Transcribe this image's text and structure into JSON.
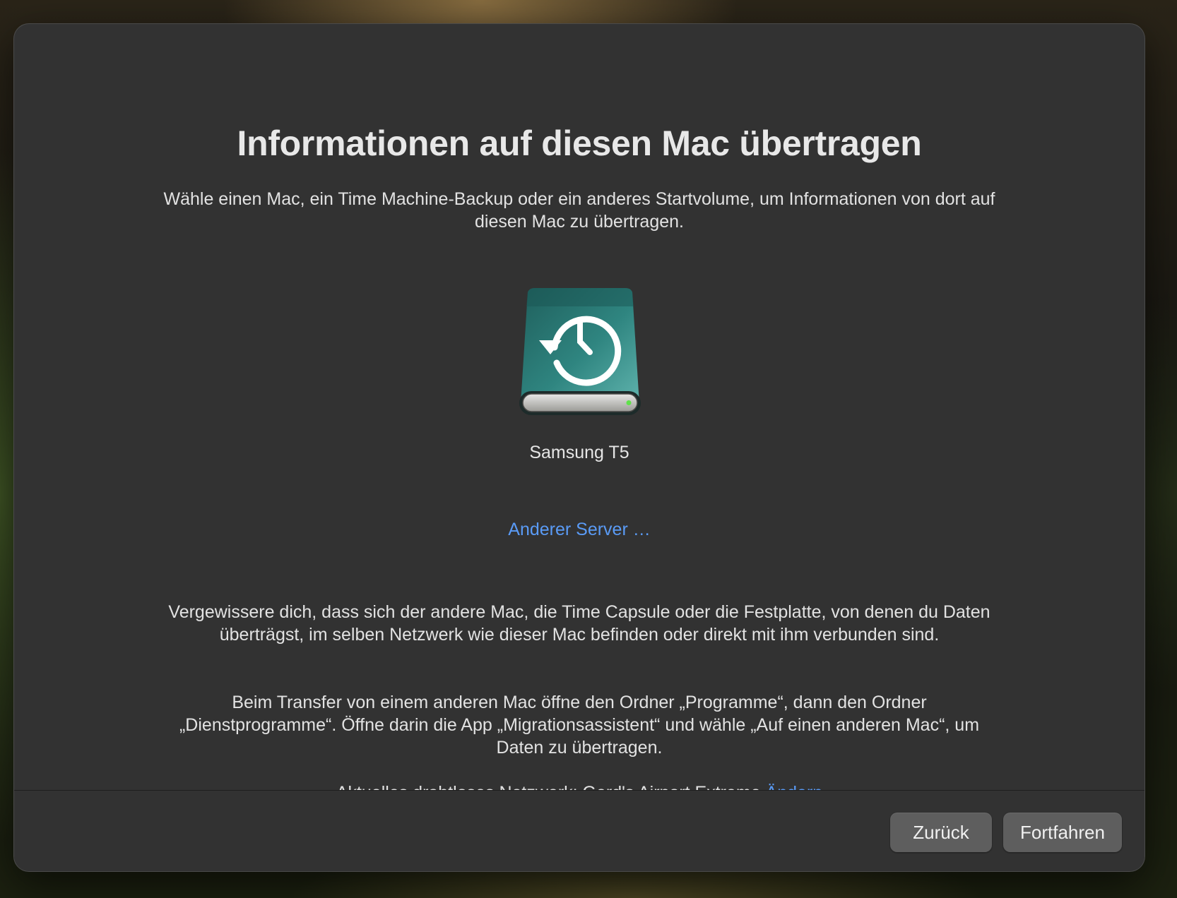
{
  "dialog": {
    "title": "Informationen auf diesen Mac übertragen",
    "subtitle": "Wähle einen Mac, ein Time Machine-Backup oder ein anderes Startvolume, um Informationen von dort auf diesen Mac zu übertragen."
  },
  "source": {
    "name": "Samsung T5",
    "icon": "time-machine-drive-icon"
  },
  "other_server_link": "Anderer Server …",
  "info": {
    "paragraph1": "Vergewissere dich, dass sich der andere Mac, die Time Capsule oder die Festplatte, von denen du Daten überträgst, im selben Netzwerk wie dieser Mac befinden oder direkt mit ihm verbunden sind.",
    "paragraph2": "Beim Transfer von einem anderen Mac öffne den Ordner „Programme“, dann den Ordner „Dienstprogramme“. Öffne darin die App „Migrationsassistent“ und wähle „Auf einen anderen Mac“, um Daten zu übertragen.",
    "network_label": "Aktuelles drahtloses Netzwerk:",
    "network_name": "Gerd's Airport Extreme",
    "change_link": "Ändern"
  },
  "buttons": {
    "back": "Zurück",
    "continue": "Fortfahren"
  },
  "colors": {
    "link": "#5a9bf6",
    "window_bg": "#323232",
    "button_bg": "#5e5e5e"
  }
}
